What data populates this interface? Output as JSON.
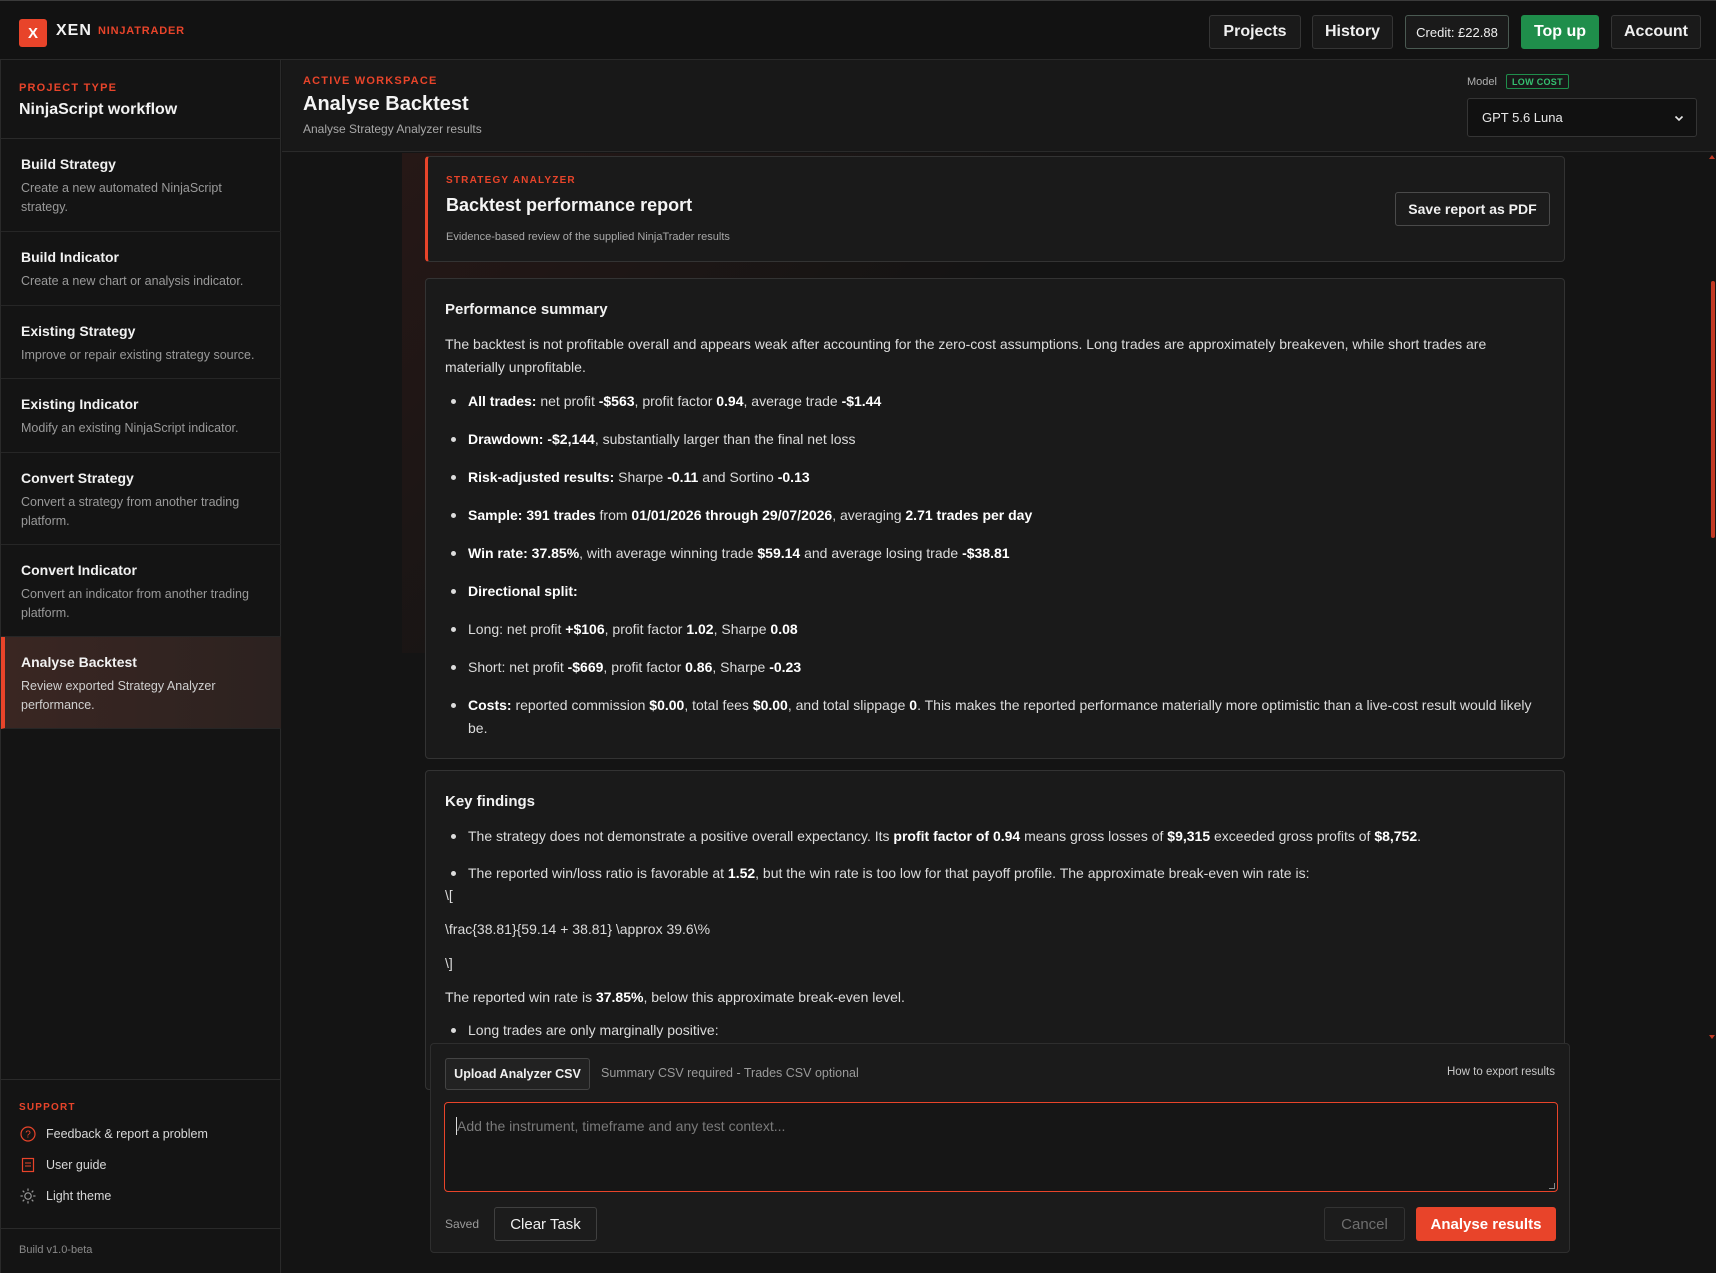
{
  "app": {
    "logo_letter": "X",
    "name": "XEN",
    "product": "NINJATRADER"
  },
  "topbar": {
    "projects": "Projects",
    "history": "History",
    "credit": "Credit: £22.88",
    "topup": "Top up",
    "account": "Account"
  },
  "sidebar": {
    "project_type_label": "PROJECT TYPE",
    "project_type": "NinjaScript workflow",
    "items": [
      {
        "title": "Build Strategy",
        "desc": "Create a new automated NinjaScript strategy."
      },
      {
        "title": "Build Indicator",
        "desc": "Create a new chart or analysis indicator."
      },
      {
        "title": "Existing Strategy",
        "desc": "Improve or repair existing strategy source."
      },
      {
        "title": "Existing Indicator",
        "desc": "Modify an existing NinjaScript indicator."
      },
      {
        "title": "Convert Strategy",
        "desc": "Convert a strategy from another trading platform."
      },
      {
        "title": "Convert Indicator",
        "desc": "Convert an indicator from another trading platform."
      },
      {
        "title": "Analyse Backtest",
        "desc": "Review exported Strategy Analyzer performance."
      }
    ],
    "support_label": "SUPPORT",
    "support": [
      {
        "label": "Feedback & report a problem",
        "icon": "question-circle-icon"
      },
      {
        "label": "User guide",
        "icon": "document-icon"
      },
      {
        "label": "Light theme",
        "icon": "sun-icon"
      }
    ],
    "build": "Build v1.0-beta"
  },
  "header": {
    "ws_label": "ACTIVE WORKSPACE",
    "title": "Analyse Backtest",
    "subtitle": "Analyse Strategy Analyzer results",
    "model_label": "Model",
    "model_badge": "LOW COST",
    "model_value": "GPT 5.6 Luna"
  },
  "report": {
    "label": "STRATEGY ANALYZER",
    "title": "Backtest performance report",
    "subtitle": "Evidence-based review of the supplied NinjaTrader results",
    "save_btn": "Save report as PDF"
  },
  "summary": {
    "title": "Performance summary",
    "intro": "The backtest is not profitable overall and appears weak after accounting for the zero-cost assumptions. Long trades are approximately breakeven, while short trades are materially unprofitable.",
    "bullets": {
      "b0": {
        "k": "All trades:",
        "t1": " net profit ",
        "v1": "-$563",
        "t2": ", profit factor ",
        "v2": "0.94",
        "t3": ", average trade ",
        "v3": "-$1.44"
      },
      "b1": {
        "k": "Drawdown:",
        "t1": " ",
        "v1": "-$2,144",
        "t2": ", substantially larger than the final net loss"
      },
      "b2": {
        "k": "Risk-adjusted results:",
        "t1": " Sharpe ",
        "v1": "-0.11",
        "t2": " and Sortino ",
        "v2": "-0.13"
      },
      "b3": {
        "k": "Sample:",
        "t1": " ",
        "v1": "391 trades",
        "t2": " from ",
        "v2": "01/01/2026 through 29/07/2026",
        "t3": ", averaging ",
        "v3": "2.71 trades per day"
      },
      "b4": {
        "k": "Win rate:",
        "t1": " ",
        "v1": "37.85%",
        "t2": ", with average winning trade ",
        "v2": "$59.14",
        "t3": " and average losing trade ",
        "v3": "-$38.81"
      },
      "b5": {
        "k": "Directional split:"
      },
      "b6": {
        "t1": "Long: net profit ",
        "v1": "+$106",
        "t2": ", profit factor ",
        "v2": "1.02",
        "t3": ", Sharpe ",
        "v3": "0.08"
      },
      "b7": {
        "t1": "Short: net profit ",
        "v1": "-$669",
        "t2": ", profit factor ",
        "v2": "0.86",
        "t3": ", Sharpe ",
        "v3": "-0.23"
      },
      "b8": {
        "k": "Costs:",
        "t1": " reported commission ",
        "v1": "$0.00",
        "t2": ", total fees ",
        "v2": "$0.00",
        "t3": ", and total slippage ",
        "v3": "0",
        "t4": ". This makes the reported performance materially more optimistic than a live-cost result would likely be."
      }
    }
  },
  "findings": {
    "title": "Key findings",
    "f0": {
      "t1": "The strategy does not demonstrate a positive overall expectancy. Its ",
      "v1": "profit factor of 0.94",
      "t2": " means gross losses of ",
      "v2": "$9,315",
      "t3": " exceeded gross profits of ",
      "v3": "$8,752",
      "t4": "."
    },
    "f1": {
      "t1": "The reported win/loss ratio is favorable at ",
      "v1": "1.52",
      "t2": ", but the win rate is too low for that payoff profile. The approximate break-even win rate is:"
    },
    "math_open": "\\[",
    "math_body": "\\frac{38.81}{59.14 + 38.81} \\approx 39.6\\%",
    "math_close": "\\]",
    "after": {
      "t1": "The reported win rate is ",
      "v1": "37.85%",
      "t2": ", below this approximate break-even level."
    },
    "f2": "Long trades are only marginally positive:"
  },
  "composer": {
    "upload_btn": "Upload Analyzer CSV",
    "upload_hint": "Summary CSV required - Trades CSV optional",
    "how_link": "How to export results",
    "placeholder": "Add the instrument, timeframe and any test context...",
    "saved": "Saved",
    "clear": "Clear Task",
    "cancel": "Cancel",
    "analyse": "Analyse results"
  },
  "colors": {
    "accent": "#e8442a",
    "green": "#1f8e4b",
    "bg": "#151515"
  }
}
